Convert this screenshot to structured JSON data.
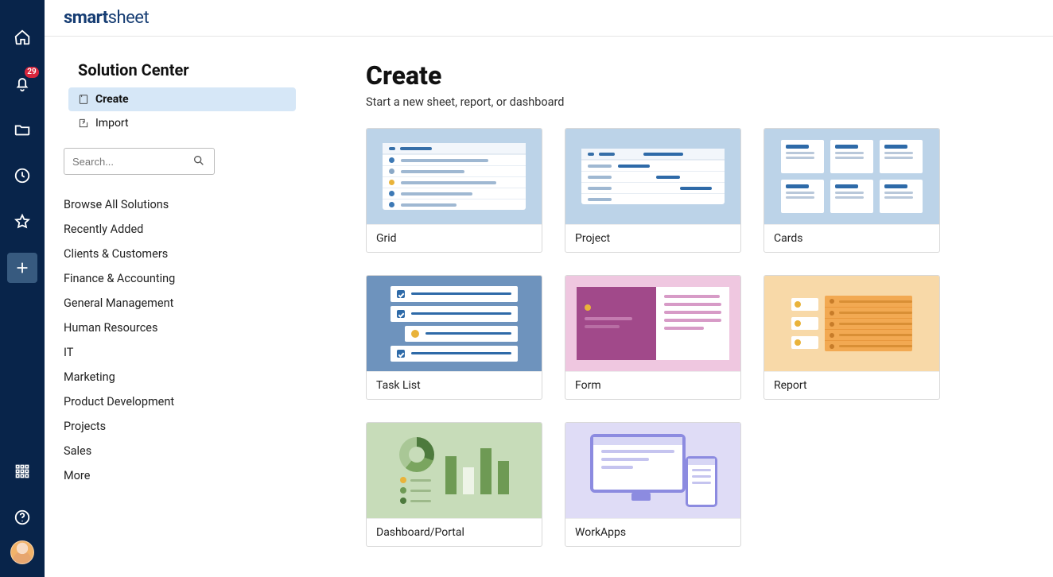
{
  "brand": {
    "bold": "smart",
    "light": "sheet"
  },
  "notifications": {
    "count": "29"
  },
  "sidebar": {
    "title": "Solution Center",
    "nav": {
      "create": "Create",
      "import": "Import"
    },
    "search": {
      "placeholder": "Search..."
    },
    "links": [
      "Browse All Solutions",
      "Recently Added",
      "Clients & Customers",
      "Finance & Accounting",
      "General Management",
      "Human Resources",
      "IT",
      "Marketing",
      "Product Development",
      "Projects",
      "Sales",
      "More"
    ]
  },
  "main": {
    "title": "Create",
    "subtitle": "Start a new sheet, report, or dashboard",
    "tiles": [
      {
        "id": "grid",
        "label": "Grid"
      },
      {
        "id": "project",
        "label": "Project"
      },
      {
        "id": "cards",
        "label": "Cards"
      },
      {
        "id": "tasklist",
        "label": "Task List"
      },
      {
        "id": "form",
        "label": "Form"
      },
      {
        "id": "report",
        "label": "Report"
      },
      {
        "id": "dashboard",
        "label": "Dashboard/Portal"
      },
      {
        "id": "workapps",
        "label": "WorkApps"
      }
    ]
  }
}
